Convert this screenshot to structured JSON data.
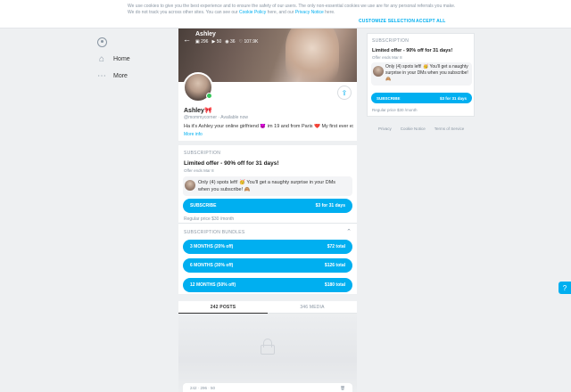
{
  "cookie_banner": {
    "text_prefix": "We use cookies to give you the best experience and to ensure the safety of our users. The only non-essential cookies we use are for any personal referrals you make. We do not track you across other sites. You can see our ",
    "cookie_policy_link": "Cookie Policy",
    "text_middle": " here, and our ",
    "privacy_link": "Privacy Notice",
    "text_suffix": " here.",
    "customize_label": "CUSTOMIZE SELECTION",
    "accept_label": "ACCEPT ALL"
  },
  "nav": {
    "items": [
      {
        "label": "",
        "icon": "user-icon"
      },
      {
        "label": "Home",
        "icon": "home-icon"
      },
      {
        "label": "More",
        "icon": "more-icon"
      }
    ]
  },
  "profile": {
    "cover_name": "Ashley",
    "stats": {
      "photos": "296",
      "videos": "50",
      "streams": "36",
      "likes": "107.9K"
    },
    "name": "Ashley🎀",
    "handle": "@mommycorner",
    "status": "Available now",
    "bio": "Ha it's Ashley your online girlfriend 😈 im 19 and from Paris ❤️ My first ever ex",
    "more_info": "More info"
  },
  "subscription": {
    "header": "SUBSCRIPTION",
    "offer_title": "Limited offer - 90% off for 31 days!",
    "offer_ends": "Offer ends Mar 8",
    "message": "Only (4) spots left! 🥳 You'll get a naughty surprise in your DMs when you subscribe! 🙈",
    "subscribe_label": "SUBSCRIBE",
    "subscribe_price": "$3 for 31 days",
    "regular_price": "Regular price $30 /month"
  },
  "bundles": {
    "header": "SUBSCRIPTION BUNDLES",
    "items": [
      {
        "label": "3 MONTHS (20% off)",
        "price": "$72 total"
      },
      {
        "label": "6 MONTHS (30% off)",
        "price": "$126 total"
      },
      {
        "label": "12 MONTHS (50% off)",
        "price": "$180 total"
      }
    ]
  },
  "tabs": {
    "posts": "242 POSTS",
    "media": "346 MEDIA"
  },
  "post_bar": {
    "left": "242 · 296 · 50",
    "right": "🗑"
  },
  "side_subscription": {
    "header": "SUBSCRIPTION",
    "offer_title": "Limited offer - 90% off for 31 days!",
    "offer_ends": "Offer ends Mar 8",
    "message": "Only (4) spots left! 🥳 You'll get a naughty surprise in your DMs when you subscribe! 🙈",
    "subscribe_label": "SUBSCRIBE",
    "subscribe_price": "$3 for 31 days",
    "regular_price": "Regular price $30 /month"
  },
  "footer": {
    "privacy": "Privacy",
    "cookie": "Cookie Notice",
    "terms": "Terms of Service"
  },
  "colors": {
    "accent": "#00aff0",
    "online": "#34c759"
  }
}
